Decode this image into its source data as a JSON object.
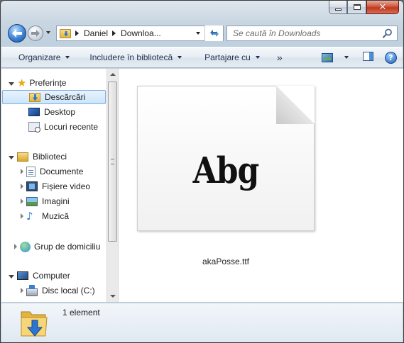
{
  "window": {
    "controls": {
      "minimize": "minimize",
      "maximize": "maximize",
      "close": "close"
    }
  },
  "address": {
    "crumbs": [
      "Daniel",
      "Downloa..."
    ],
    "search_placeholder": "Se caută în Downloads"
  },
  "commands": {
    "organize": "Organizare",
    "include": "Includere în bibliotecă",
    "share": "Partajare cu",
    "more": "»"
  },
  "nav": {
    "favorites": "Preferințe",
    "downloads": "Descărcări",
    "desktop": "Desktop",
    "recent": "Locuri recente",
    "libraries": "Biblioteci",
    "documents": "Documente",
    "videos": "Fișiere video",
    "pictures": "Imagini",
    "music": "Muzică",
    "homegroup": "Grup de domiciliu",
    "computer": "Computer",
    "local_disk": "Disc local (C:)"
  },
  "file": {
    "preview_text": "Abg",
    "name": "akaPosse.ttf"
  },
  "status": {
    "count": "1 element"
  },
  "colors": {
    "accent": "#3d84d6",
    "close": "#c0381c",
    "selection": "#cce5fb"
  }
}
